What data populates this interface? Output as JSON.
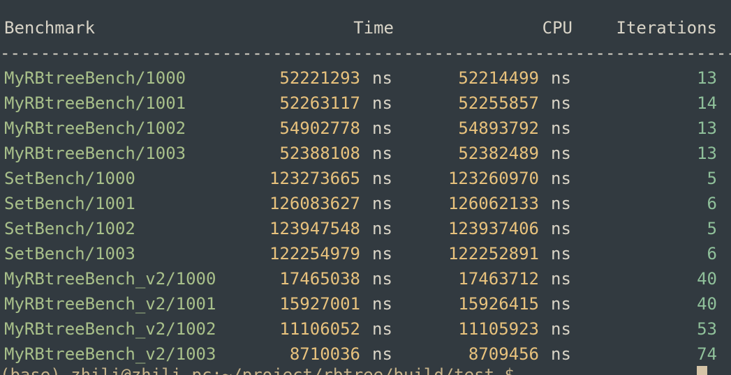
{
  "colors": {
    "background": "#323a40",
    "name": "#a8c08a",
    "number": "#e8c27d",
    "text": "#d9d4c7",
    "iterations": "#8fc09a"
  },
  "rule_text": "--------------------------------------------------------------------------------------------",
  "header": {
    "benchmark": "Benchmark",
    "time": "Time",
    "cpu": "CPU",
    "iterations": "Iterations"
  },
  "rows": [
    {
      "name": "MyRBtreeBench/1000",
      "time": "52221293",
      "time_unit": "ns",
      "cpu": "52214499",
      "cpu_unit": "ns",
      "iterations": "13"
    },
    {
      "name": "MyRBtreeBench/1001",
      "time": "52263117",
      "time_unit": "ns",
      "cpu": "52255857",
      "cpu_unit": "ns",
      "iterations": "14"
    },
    {
      "name": "MyRBtreeBench/1002",
      "time": "54902778",
      "time_unit": "ns",
      "cpu": "54893792",
      "cpu_unit": "ns",
      "iterations": "13"
    },
    {
      "name": "MyRBtreeBench/1003",
      "time": "52388108",
      "time_unit": "ns",
      "cpu": "52382489",
      "cpu_unit": "ns",
      "iterations": "13"
    },
    {
      "name": "SetBench/1000",
      "time": "123273665",
      "time_unit": "ns",
      "cpu": "123260970",
      "cpu_unit": "ns",
      "iterations": "5"
    },
    {
      "name": "SetBench/1001",
      "time": "126083627",
      "time_unit": "ns",
      "cpu": "126062133",
      "cpu_unit": "ns",
      "iterations": "6"
    },
    {
      "name": "SetBench/1002",
      "time": "123947548",
      "time_unit": "ns",
      "cpu": "123937406",
      "cpu_unit": "ns",
      "iterations": "5"
    },
    {
      "name": "SetBench/1003",
      "time": "122254979",
      "time_unit": "ns",
      "cpu": "122252891",
      "cpu_unit": "ns",
      "iterations": "6"
    },
    {
      "name": "MyRBtreeBench_v2/1000",
      "time": "17465038",
      "time_unit": "ns",
      "cpu": "17463712",
      "cpu_unit": "ns",
      "iterations": "40"
    },
    {
      "name": "MyRBtreeBench_v2/1001",
      "time": "15927001",
      "time_unit": "ns",
      "cpu": "15926415",
      "cpu_unit": "ns",
      "iterations": "40"
    },
    {
      "name": "MyRBtreeBench_v2/1002",
      "time": "11106052",
      "time_unit": "ns",
      "cpu": "11105923",
      "cpu_unit": "ns",
      "iterations": "53"
    },
    {
      "name": "MyRBtreeBench_v2/1003",
      "time": "8710036",
      "time_unit": "ns",
      "cpu": "8709456",
      "cpu_unit": "ns",
      "iterations": "74"
    }
  ],
  "prompt_text": "(base) zhili@zhili-pc:~/project/rbtree/build/test $"
}
